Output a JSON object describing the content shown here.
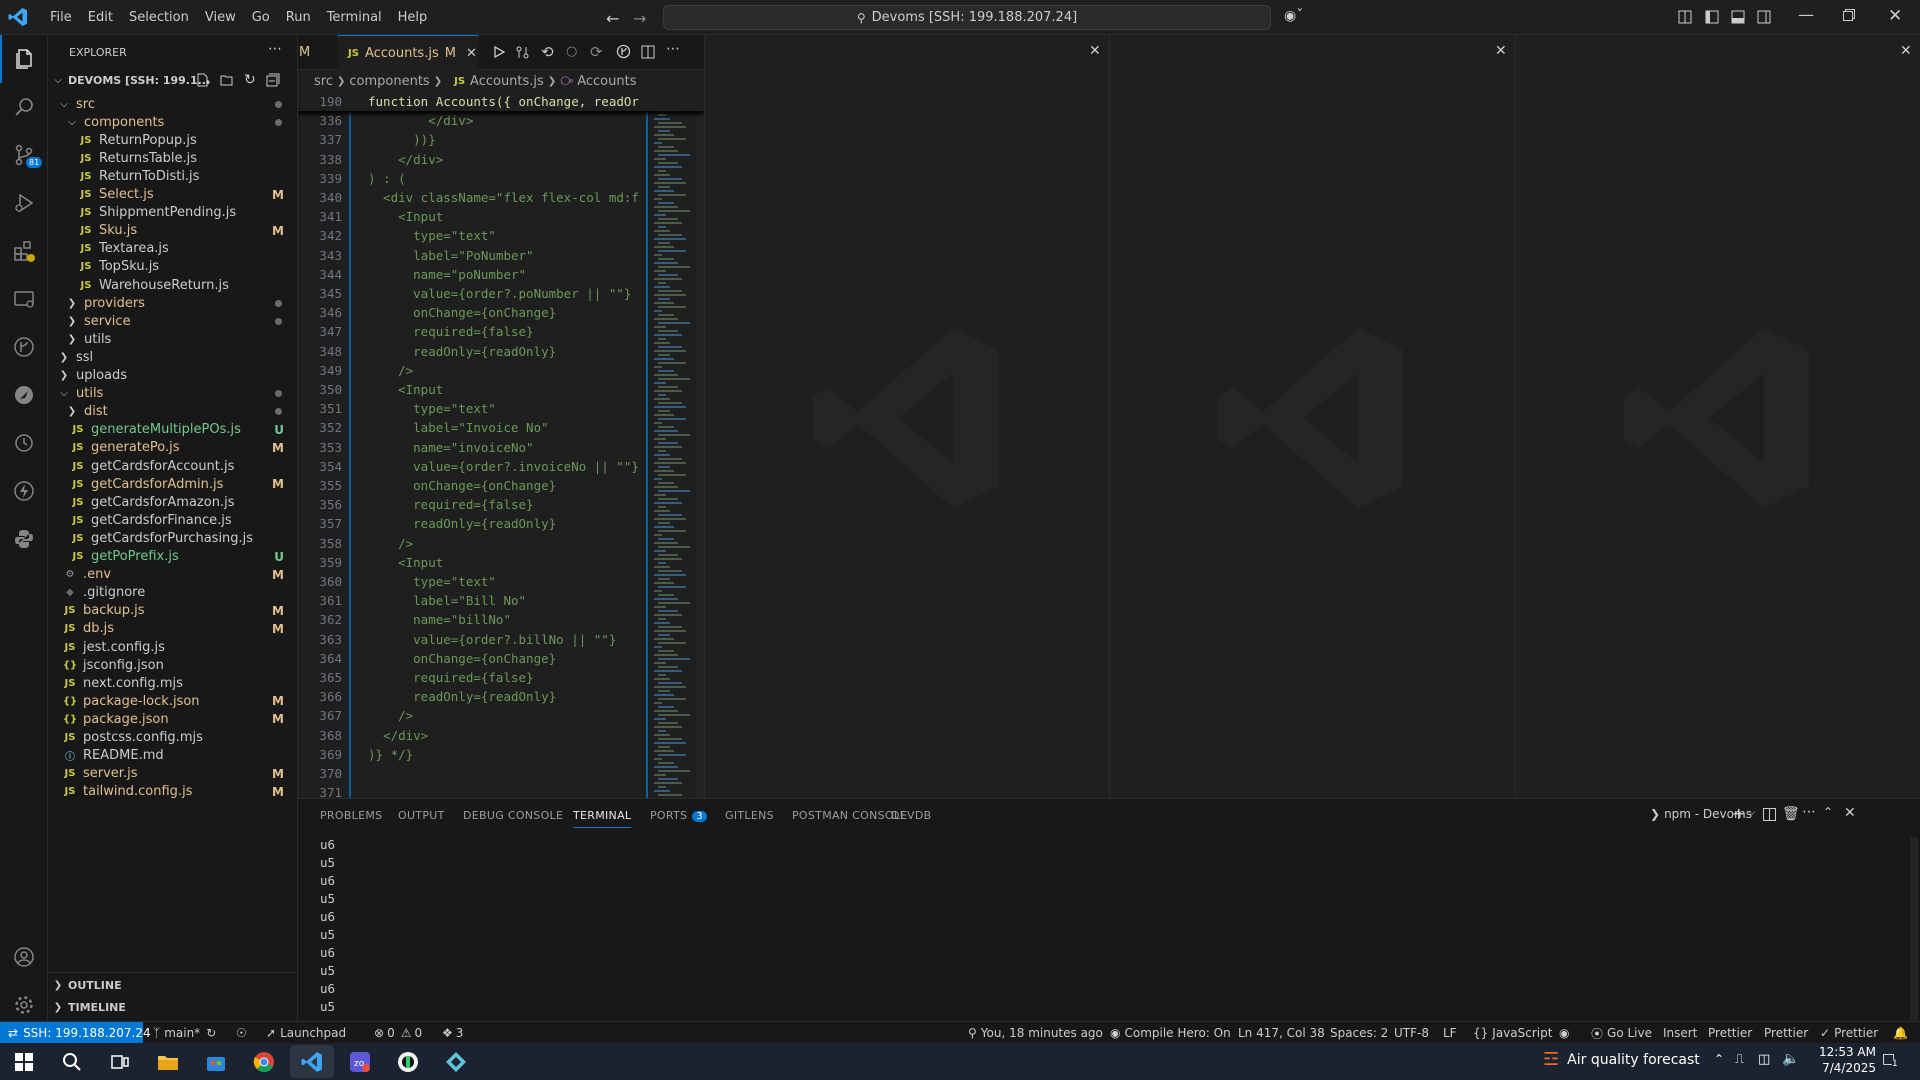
{
  "titlebar": {
    "menu": [
      "File",
      "Edit",
      "Selection",
      "View",
      "Go",
      "Run",
      "Terminal",
      "Help"
    ],
    "command_center": "Devoms [SSH: 199.188.207.24]"
  },
  "activity": {
    "scm_badge": "81"
  },
  "explorer": {
    "title": "EXPLORER",
    "workspace": "DEVOMS [SSH: 199.1...",
    "items": [
      {
        "label": "src",
        "kind": "folder-open",
        "indent": 1,
        "status": "",
        "dot": true
      },
      {
        "label": "components",
        "kind": "folder-open",
        "indent": 2,
        "status": "",
        "dot": true
      },
      {
        "label": "ReturnPopup.js",
        "kind": "js",
        "indent": 3,
        "status": ""
      },
      {
        "label": "ReturnsTable.js",
        "kind": "js",
        "indent": 3,
        "status": ""
      },
      {
        "label": "ReturnToDisti.js",
        "kind": "js",
        "indent": 3,
        "status": ""
      },
      {
        "label": "Select.js",
        "kind": "js",
        "indent": 3,
        "status": "M"
      },
      {
        "label": "ShippmentPending.js",
        "kind": "js",
        "indent": 3,
        "status": ""
      },
      {
        "label": "Sku.js",
        "kind": "js",
        "indent": 3,
        "status": "M"
      },
      {
        "label": "Textarea.js",
        "kind": "js",
        "indent": 3,
        "status": ""
      },
      {
        "label": "TopSku.js",
        "kind": "js",
        "indent": 3,
        "status": ""
      },
      {
        "label": "WarehouseReturn.js",
        "kind": "js",
        "indent": 3,
        "status": ""
      },
      {
        "label": "providers",
        "kind": "folder",
        "indent": 2,
        "status": "",
        "dot": true
      },
      {
        "label": "service",
        "kind": "folder",
        "indent": 2,
        "status": "",
        "dot": true
      },
      {
        "label": "utils",
        "kind": "folder",
        "indent": 2,
        "status": ""
      },
      {
        "label": "ssl",
        "kind": "folder",
        "indent": 1,
        "status": ""
      },
      {
        "label": "uploads",
        "kind": "folder",
        "indent": 1,
        "status": ""
      },
      {
        "label": "utils",
        "kind": "folder-open",
        "indent": 1,
        "status": "",
        "dot": true
      },
      {
        "label": "dist",
        "kind": "folder",
        "indent": 2,
        "status": "",
        "dot": true
      },
      {
        "label": "generateMultiplePOs.js",
        "kind": "js",
        "indent": 2,
        "status": "U"
      },
      {
        "label": "generatePo.js",
        "kind": "js",
        "indent": 2,
        "status": "M"
      },
      {
        "label": "getCardsforAccount.js",
        "kind": "js",
        "indent": 2,
        "status": ""
      },
      {
        "label": "getCardsforAdmin.js",
        "kind": "js",
        "indent": 2,
        "status": "M"
      },
      {
        "label": "getCardsforAmazon.js",
        "kind": "js",
        "indent": 2,
        "status": ""
      },
      {
        "label": "getCardsforFinance.js",
        "kind": "js",
        "indent": 2,
        "status": ""
      },
      {
        "label": "getCardsforPurchasing.js",
        "kind": "js",
        "indent": 2,
        "status": ""
      },
      {
        "label": "getPoPrefix.js",
        "kind": "js",
        "indent": 2,
        "status": "U"
      },
      {
        "label": ".env",
        "kind": "gear",
        "indent": 1,
        "status": "M"
      },
      {
        "label": ".gitignore",
        "kind": "git",
        "indent": 1,
        "status": ""
      },
      {
        "label": "backup.js",
        "kind": "js",
        "indent": 1,
        "status": "M"
      },
      {
        "label": "db.js",
        "kind": "js",
        "indent": 1,
        "status": "M"
      },
      {
        "label": "jest.config.js",
        "kind": "js",
        "indent": 1,
        "status": ""
      },
      {
        "label": "jsconfig.json",
        "kind": "json",
        "indent": 1,
        "status": ""
      },
      {
        "label": "next.config.mjs",
        "kind": "js",
        "indent": 1,
        "status": ""
      },
      {
        "label": "package-lock.json",
        "kind": "json",
        "indent": 1,
        "status": "M"
      },
      {
        "label": "package.json",
        "kind": "json",
        "indent": 1,
        "status": "M"
      },
      {
        "label": "postcss.config.mjs",
        "kind": "js",
        "indent": 1,
        "status": ""
      },
      {
        "label": "README.md",
        "kind": "info",
        "indent": 1,
        "status": ""
      },
      {
        "label": "server.js",
        "kind": "js",
        "indent": 1,
        "status": "M"
      },
      {
        "label": "tailwind.config.js",
        "kind": "js",
        "indent": 1,
        "status": "M"
      }
    ],
    "outline": "OUTLINE",
    "timeline": "TIMELINE"
  },
  "editor": {
    "prev_tab_status": "M",
    "tab": {
      "icon": "JS",
      "label": "Accounts.js",
      "status": "M"
    },
    "breadcrumb": [
      "src",
      "components",
      "Accounts.js",
      "Accounts"
    ],
    "sticky": {
      "num": "190",
      "text": "function Accounts({ onChange, readOr"
    },
    "lines": [
      {
        "n": "336",
        "t": "        </div>"
      },
      {
        "n": "337",
        "t": "      ))}"
      },
      {
        "n": "338",
        "t": "    </div>"
      },
      {
        "n": "339",
        "t": ") : ("
      },
      {
        "n": "340",
        "t": "  <div className=\"flex flex-col md:f"
      },
      {
        "n": "341",
        "t": "    <Input"
      },
      {
        "n": "342",
        "t": "      type=\"text\""
      },
      {
        "n": "343",
        "t": "      label=\"PoNumber\""
      },
      {
        "n": "344",
        "t": "      name=\"poNumber\""
      },
      {
        "n": "345",
        "t": "      value={order?.poNumber || \"\"}"
      },
      {
        "n": "346",
        "t": "      onChange={onChange}"
      },
      {
        "n": "347",
        "t": "      required={false}"
      },
      {
        "n": "348",
        "t": "      readOnly={readOnly}"
      },
      {
        "n": "349",
        "t": "    />"
      },
      {
        "n": "350",
        "t": "    <Input"
      },
      {
        "n": "351",
        "t": "      type=\"text\""
      },
      {
        "n": "352",
        "t": "      label=\"Invoice No\""
      },
      {
        "n": "353",
        "t": "      name=\"invoiceNo\""
      },
      {
        "n": "354",
        "t": "      value={order?.invoiceNo || \"\"}"
      },
      {
        "n": "355",
        "t": "      onChange={onChange}"
      },
      {
        "n": "356",
        "t": "      required={false}"
      },
      {
        "n": "357",
        "t": "      readOnly={readOnly}"
      },
      {
        "n": "358",
        "t": "    />"
      },
      {
        "n": "359",
        "t": "    <Input"
      },
      {
        "n": "360",
        "t": "      type=\"text\""
      },
      {
        "n": "361",
        "t": "      label=\"Bill No\""
      },
      {
        "n": "362",
        "t": "      name=\"billNo\""
      },
      {
        "n": "363",
        "t": "      value={order?.billNo || \"\"}"
      },
      {
        "n": "364",
        "t": "      onChange={onChange}"
      },
      {
        "n": "365",
        "t": "      required={false}"
      },
      {
        "n": "366",
        "t": "      readOnly={readOnly}"
      },
      {
        "n": "367",
        "t": "    />"
      },
      {
        "n": "368",
        "t": "  </div>"
      },
      {
        "n": "369",
        "t": ")} */}"
      },
      {
        "n": "370",
        "t": ""
      },
      {
        "n": "371",
        "t": ""
      }
    ]
  },
  "panel": {
    "tabs": [
      "PROBLEMS",
      "OUTPUT",
      "DEBUG CONSOLE",
      "TERMINAL",
      "PORTS",
      "GITLENS",
      "POSTMAN CONSOLE",
      "DEVDB"
    ],
    "active_tab": "TERMINAL",
    "ports_badge": "3",
    "terminal_name": "npm - Devoms",
    "terminal_lines": [
      "u6",
      "u5",
      "u6",
      "u5",
      "u6",
      "u5",
      "u6",
      "u5",
      "u6",
      "u5"
    ]
  },
  "statusbar": {
    "remote": "SSH: 199.188.207.24",
    "branch": "main*",
    "launchpad": "Launchpad",
    "errors": "0",
    "warnings": "0",
    "ports": "3",
    "blame": "You, 18 minutes ago",
    "compile_hero": "Compile Hero: On",
    "position": "Ln 417, Col 38",
    "spaces": "Spaces: 2",
    "encoding": "UTF-8",
    "eol": "LF",
    "language": "JavaScript",
    "golive": "Go Live",
    "insert": "Insert",
    "prettier1": "Prettier",
    "prettier2": "Prettier",
    "prettier3": "Prettier"
  },
  "taskbar": {
    "weather": "Air quality forecast",
    "time": "12:53 AM",
    "date": "7/4/2025",
    "notification_count": "1"
  },
  "colors": {
    "accent": "#0078d4",
    "modified": "#e2c08d",
    "untracked": "#73c991",
    "js_icon": "#cbcb41"
  }
}
